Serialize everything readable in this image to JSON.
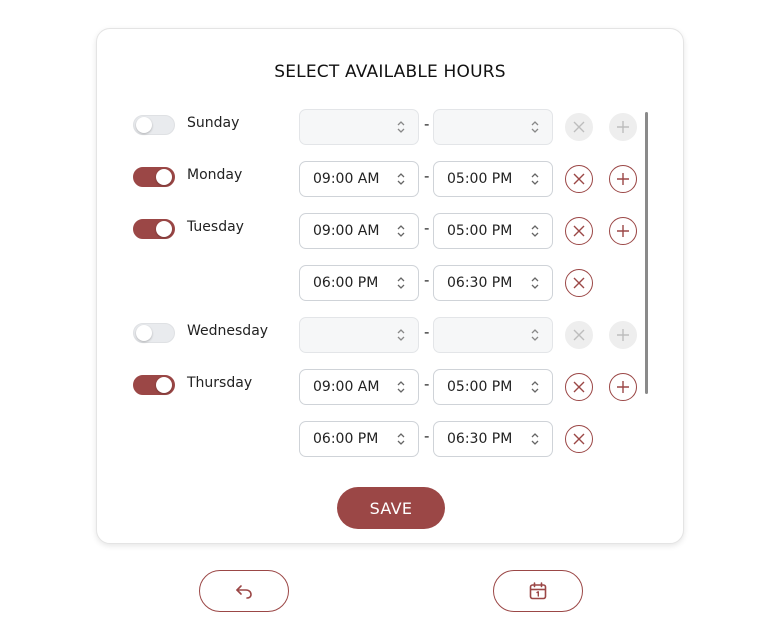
{
  "page": {
    "title": "SELECT AVAILABLE HOURS",
    "save_label": "SAVE",
    "accent_color": "#9b4746"
  },
  "rows": [
    {
      "day": "Sunday",
      "enabled": false,
      "start": "",
      "end": "",
      "separator": "-"
    },
    {
      "day": "Monday",
      "enabled": true,
      "start": "09:00 AM",
      "end": "05:00 PM",
      "separator": "-"
    },
    {
      "day": "Tuesday",
      "enabled": true,
      "start": "09:00 AM",
      "end": "05:00 PM",
      "separator": "-"
    },
    {
      "day": "",
      "enabled": true,
      "start": "06:00 PM",
      "end": "06:30 PM",
      "separator": "-"
    },
    {
      "day": "Wednesday",
      "enabled": false,
      "start": "",
      "end": "",
      "separator": "-"
    },
    {
      "day": "Thursday",
      "enabled": true,
      "start": "09:00 AM",
      "end": "05:00 PM",
      "separator": "-"
    },
    {
      "day": "",
      "enabled": true,
      "start": "06:00 PM",
      "end": "06:30 PM",
      "separator": "-"
    }
  ],
  "footer": {
    "back_icon": "undo-arrow-icon",
    "calendar_icon": "calendar-icon"
  }
}
